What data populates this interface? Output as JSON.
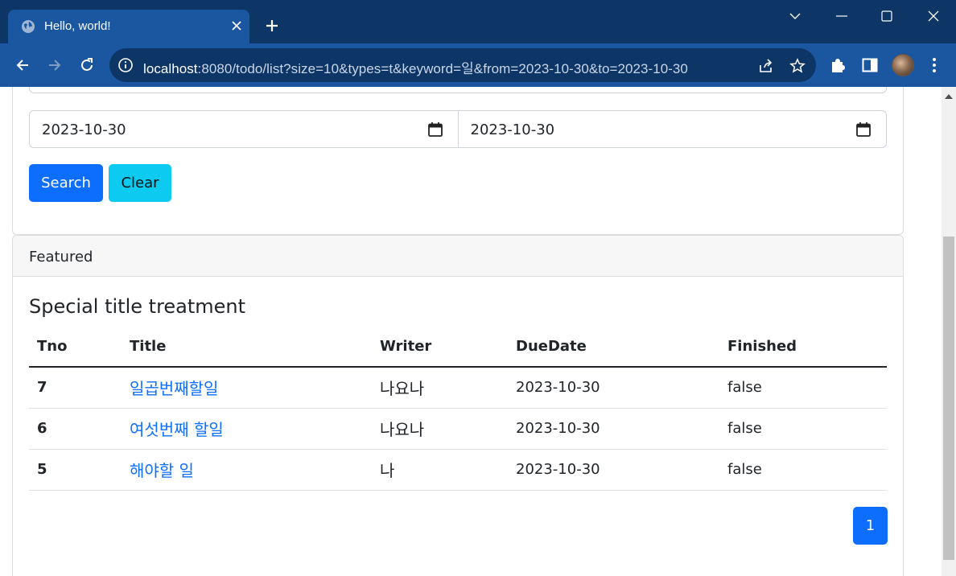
{
  "browser": {
    "tab_title": "Hello, world!",
    "url_host": "localhost",
    "url_rest": ":8080/todo/list?size=10&types=t&keyword=일&from=2023-10-30&to=2023-10-30"
  },
  "search": {
    "from_date": "2023-10-30",
    "to_date": "2023-10-30",
    "search_label": "Search",
    "clear_label": "Clear"
  },
  "list_card": {
    "header": "Featured",
    "title": "Special title treatment",
    "columns": [
      "Tno",
      "Title",
      "Writer",
      "DueDate",
      "Finished"
    ],
    "rows": [
      {
        "tno": "7",
        "title": "일곱번째할일",
        "writer": "나요나",
        "due": "2023-10-30",
        "finished": "false"
      },
      {
        "tno": "6",
        "title": "여섯번째 할일",
        "writer": "나요나",
        "due": "2023-10-30",
        "finished": "false"
      },
      {
        "tno": "5",
        "title": "해야할 일",
        "writer": "나",
        "due": "2023-10-30",
        "finished": "false"
      }
    ],
    "pagination": [
      "1"
    ]
  },
  "colors": {
    "primary": "#0d6efd",
    "info": "#0dcaf0",
    "chrome_dark": "#0d3566",
    "chrome_toolbar": "#1a57a0"
  }
}
